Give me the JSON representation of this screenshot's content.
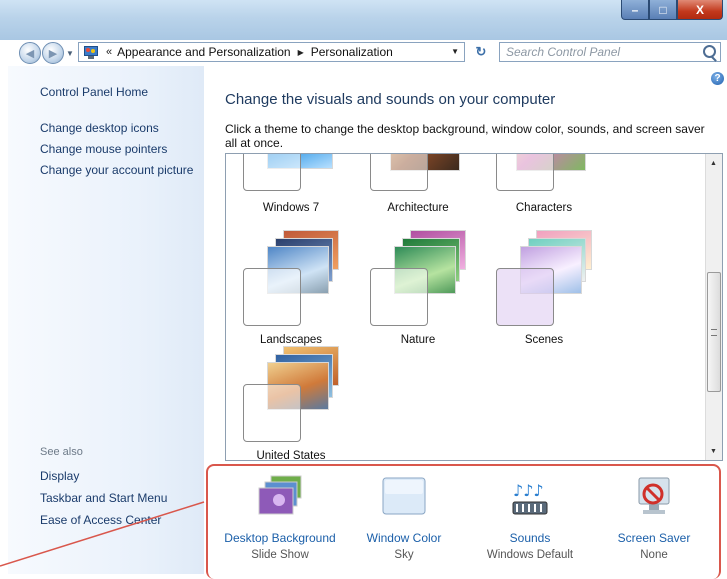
{
  "window": {
    "caption": {
      "minimize": "–",
      "maximize": "□",
      "close": "X"
    }
  },
  "nav": {
    "back_glyph": "◀",
    "forward_glyph": "▶",
    "breadcrumb": [
      "Appearance and Personalization",
      "Personalization"
    ],
    "overflow": "«",
    "separator": "▶",
    "search_placeholder": "Search Control Panel"
  },
  "sidebar": {
    "links": [
      "Control Panel Home",
      "Change desktop icons",
      "Change mouse pointers",
      "Change your account picture"
    ],
    "see_also_label": "See also",
    "see_also": [
      "Display",
      "Taskbar and Start Menu",
      "Ease of Access Center"
    ]
  },
  "main": {
    "heading": "Change the visuals and sounds on your computer",
    "description": "Click a theme to change the desktop background, window color, sounds, and screen saver all at once.",
    "themes": [
      {
        "label": "Windows 7",
        "color": "#2f7fd4"
      },
      {
        "label": "Architecture",
        "color": "#b86a3a"
      },
      {
        "label": "Characters",
        "color": "#8fb55a"
      },
      {
        "label": "Landscapes",
        "color": "#4f7fb8"
      },
      {
        "label": "Nature",
        "color": "#3f9a4f"
      },
      {
        "label": "Scenes",
        "color": "#8fa0d8"
      },
      {
        "label": "United States",
        "color": "#c98a4a"
      }
    ]
  },
  "settings": [
    {
      "name": "Desktop Background",
      "value": "Slide Show",
      "icon": "desktop-background-icon"
    },
    {
      "name": "Window Color",
      "value": "Sky",
      "icon": "window-color-icon"
    },
    {
      "name": "Sounds",
      "value": "Windows Default",
      "icon": "sounds-icon"
    },
    {
      "name": "Screen Saver",
      "value": "None",
      "icon": "screen-saver-icon"
    }
  ],
  "colors": {
    "highlight_border": "#d9574c",
    "link": "#1a3b6b"
  }
}
